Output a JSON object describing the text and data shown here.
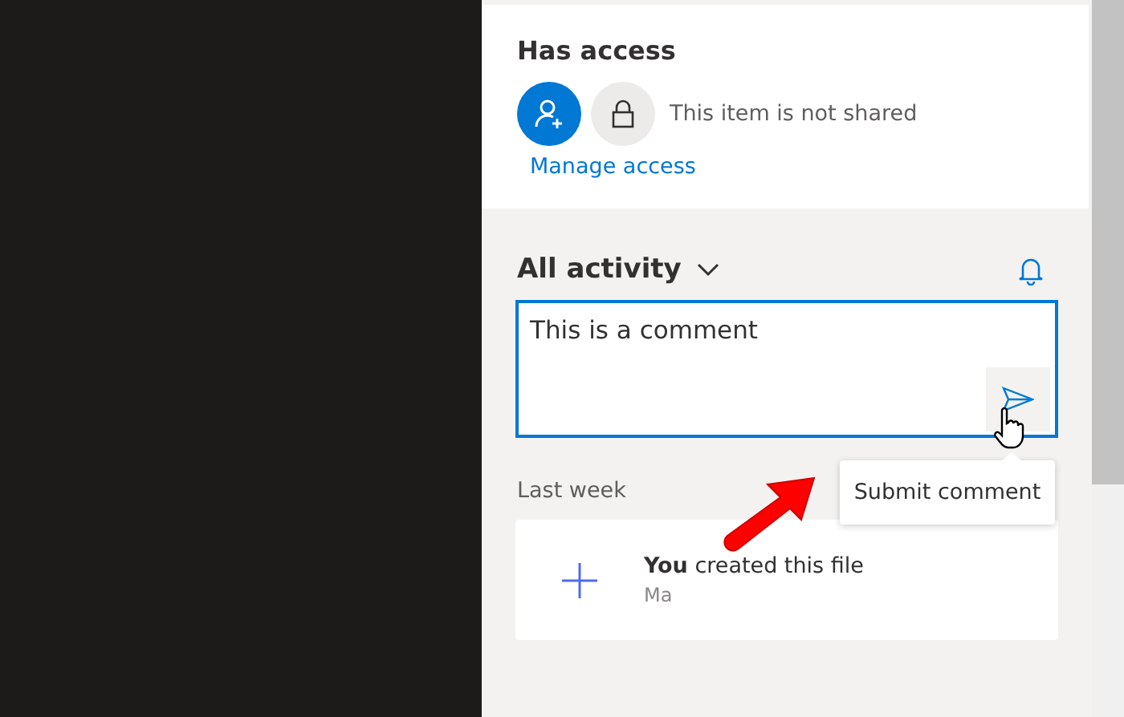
{
  "sharing": {
    "heading": "Has access",
    "status": "This item is not shared",
    "link": "Manage access"
  },
  "activity": {
    "heading": "All activity",
    "comment": {
      "value": "This is a comment"
    },
    "tooltip": "Submit comment",
    "groups": [
      {
        "label": "Last week",
        "items": [
          {
            "title": "**You** created this file",
            "subtitle": "Ma"
          }
        ]
      }
    ]
  }
}
